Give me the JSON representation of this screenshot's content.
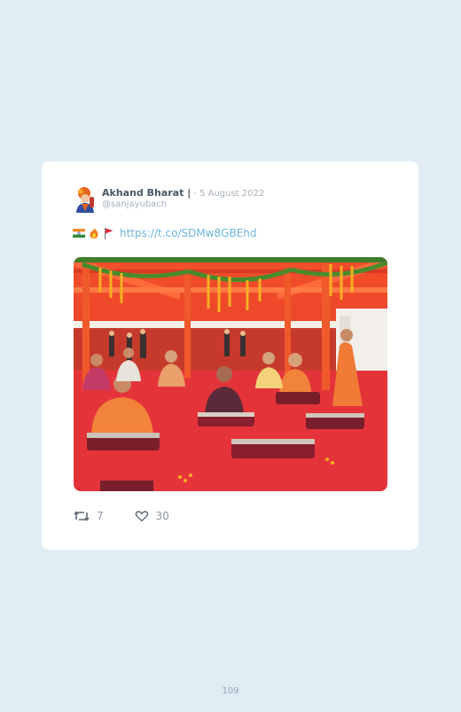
{
  "tweet": {
    "author_name": "Akhand Bharat |",
    "date": "5 August 2022",
    "handle": "@sanjayubach",
    "link": "https://t.co/SDMw8GBEhd",
    "emojis": [
      "india-flag-icon",
      "fire-icon",
      "saffron-flag-icon"
    ],
    "image_alt": "Priests seated on cushions at a ceremony under an orange pavilion with red carpet",
    "retweets": "7",
    "likes": "30"
  },
  "page_number": "109",
  "colors": {
    "background": "#e1edf5",
    "card": "#ffffff",
    "link": "#6cb6dd",
    "name": "#4a5866",
    "muted": "#a5b0ba"
  }
}
